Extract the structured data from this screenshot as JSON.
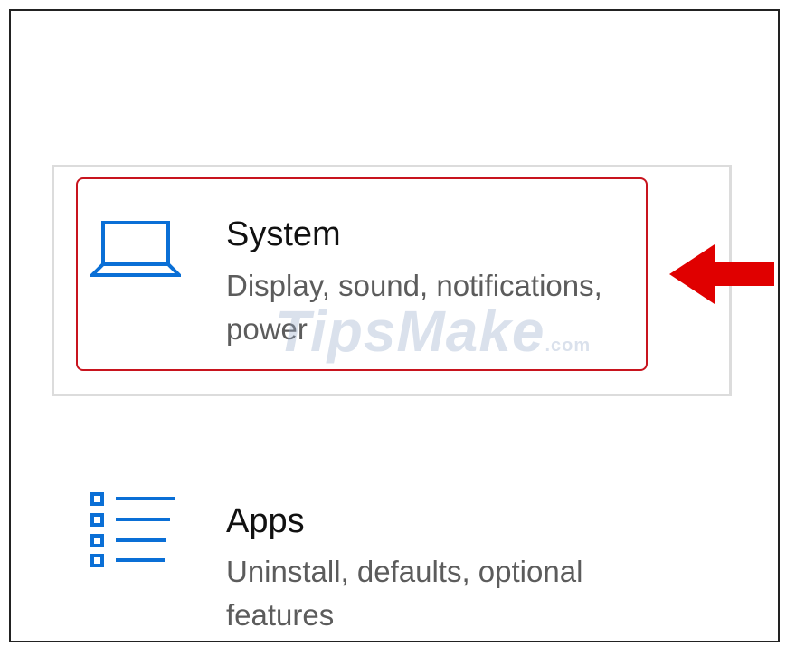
{
  "system": {
    "title": "System",
    "description": "Display, sound, notifications, power",
    "icon": "laptop-icon"
  },
  "apps": {
    "title": "Apps",
    "description": "Uninstall, defaults, optional features",
    "icon": "apps-list-icon"
  },
  "watermark": {
    "main": "TipsMake",
    "suffix": ".com"
  },
  "colors": {
    "accent": "#0a6fd6",
    "highlight": "#c8141e",
    "arrow": "#e00000"
  }
}
